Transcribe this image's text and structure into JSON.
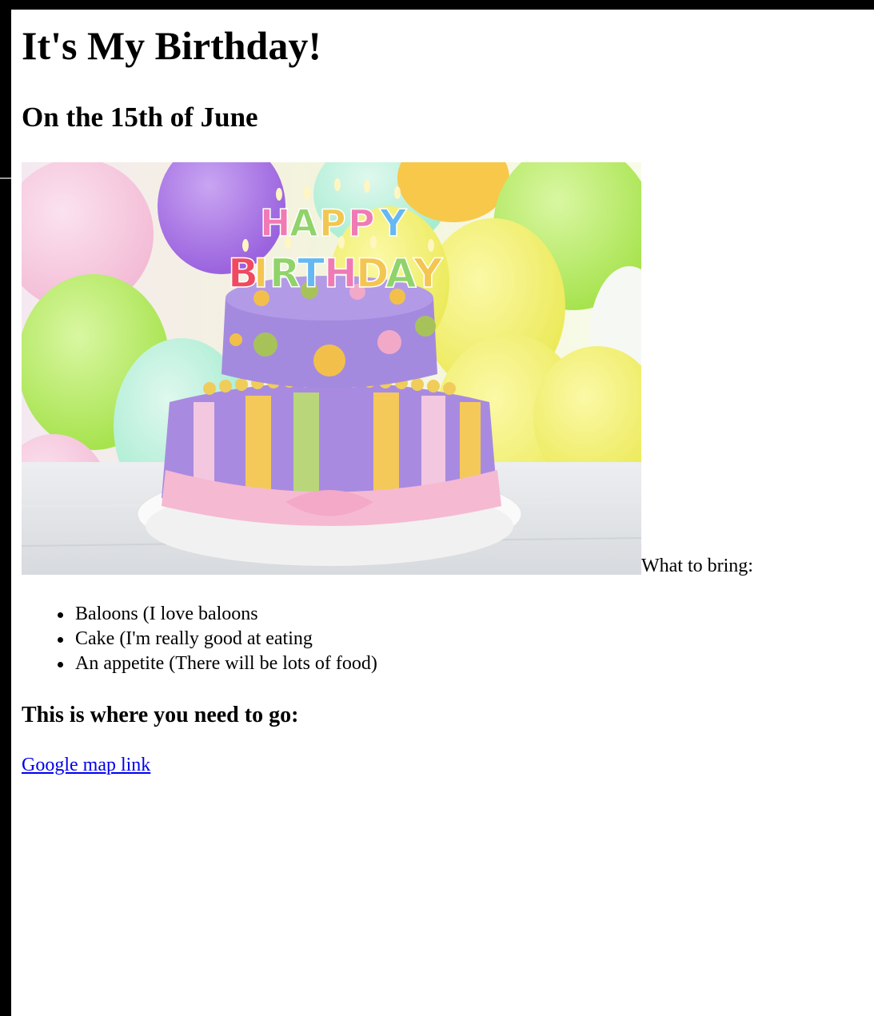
{
  "page": {
    "title": "It's My Birthday!",
    "subtitle": "On the 15th of June",
    "image": {
      "caption_text": "HAPPY BIRTHDAY",
      "description_icon": "birthday-cake-image"
    },
    "bring_label": "What to bring:",
    "bring_items": [
      "Baloons (I love baloons",
      "Cake (I'm really good at eating",
      "An appetite (There will be lots of food)"
    ],
    "directions_heading": "This is where you need to go:",
    "map_link_text": "Google map link"
  },
  "colors": {
    "link": "#0000ee",
    "frame": "#000000"
  }
}
